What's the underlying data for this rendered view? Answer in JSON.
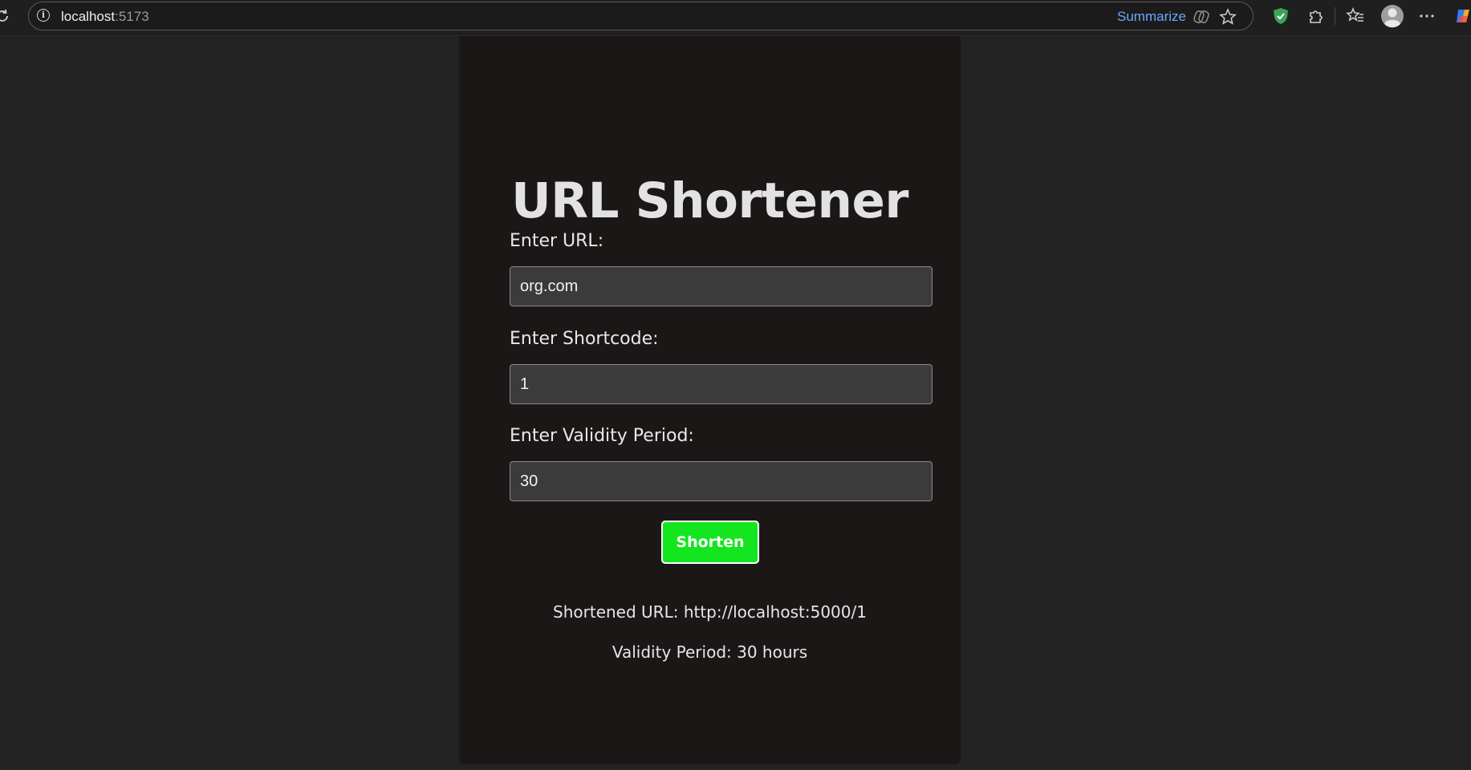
{
  "browser": {
    "url_host": "localhost",
    "url_port": ":5173",
    "summarize_label": "Summarize",
    "icons": [
      "reload-icon",
      "info-icon",
      "copilot-summarize-icon",
      "favorite-star-icon",
      "shield-icon",
      "extensions-icon",
      "favorites-icon",
      "profile-icon",
      "more-icon",
      "copilot-icon"
    ]
  },
  "app": {
    "title": "URL Shortener",
    "url_field": {
      "label": "Enter URL:",
      "value": "org.com"
    },
    "shortcode_field": {
      "label": "Enter Shortcode:",
      "value": "1"
    },
    "validity_field": {
      "label": "Enter Validity Period:",
      "value": "30"
    },
    "shorten_button": "Shorten",
    "result_url": "Shortened URL: http://localhost:5000/1",
    "result_validity": "Validity Period: 30 hours"
  },
  "colors": {
    "page_bg": "#232323",
    "panel_bg": "#1c1717",
    "button_bg": "#13e51f",
    "link_accent": "#6aa7ff"
  }
}
